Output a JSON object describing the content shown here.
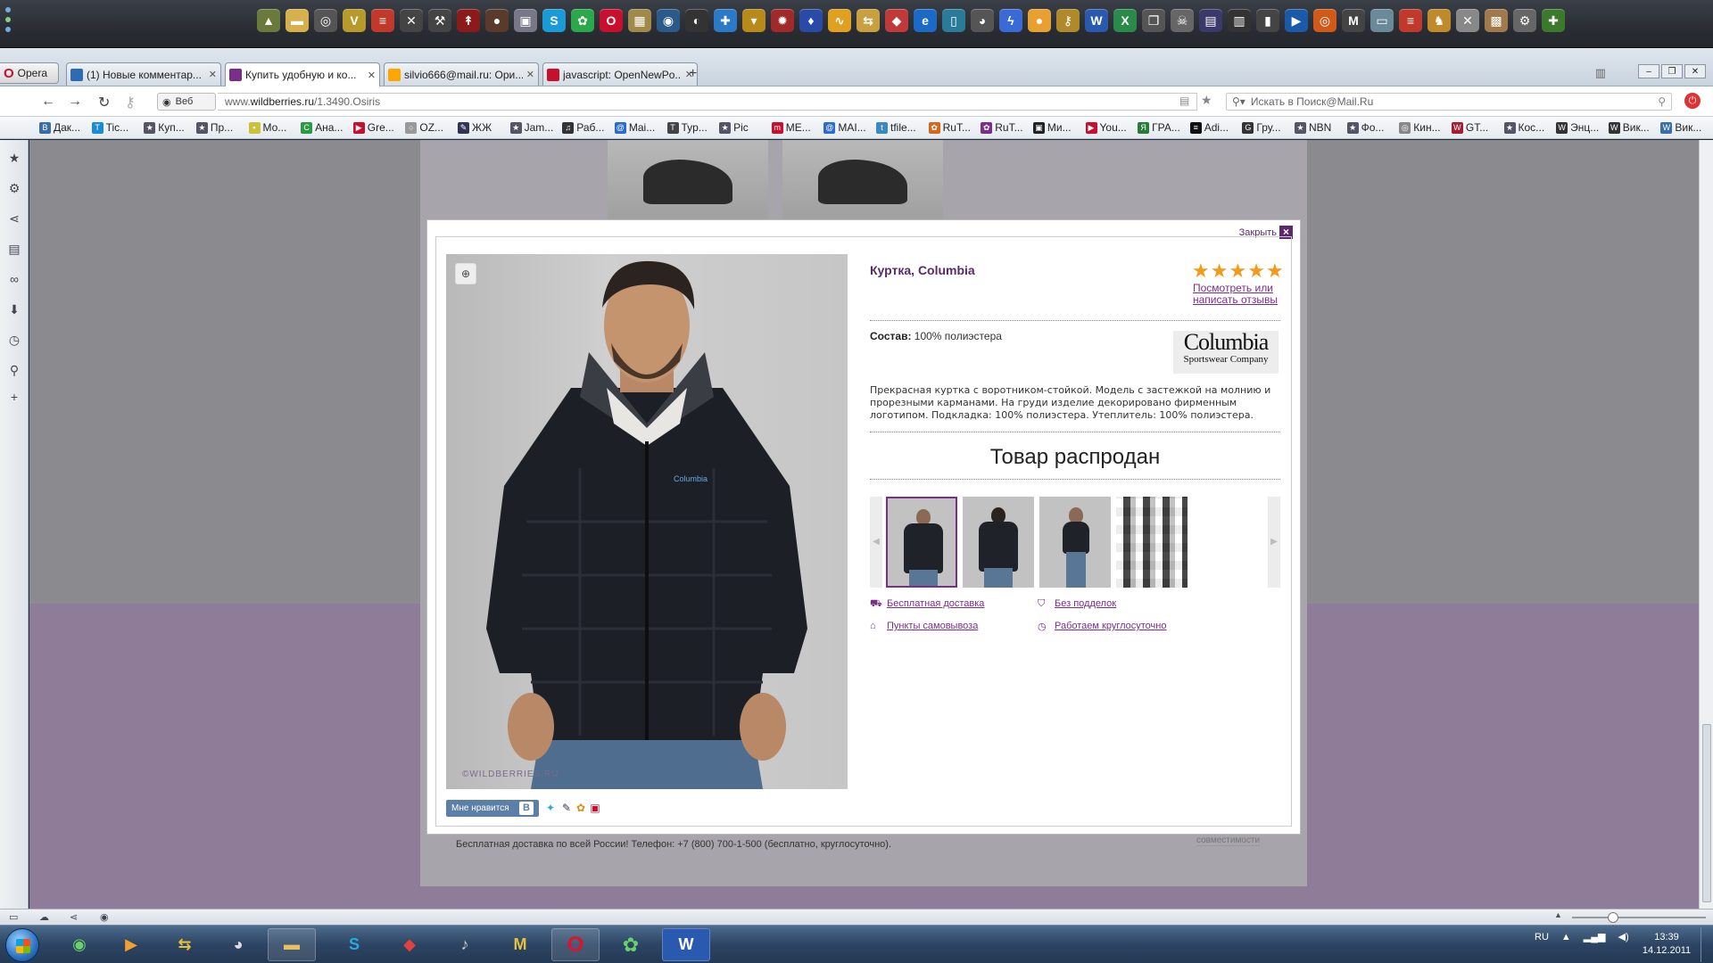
{
  "browser": {
    "menu_label": "Opera",
    "tabs": [
      {
        "title": "(1) Новые комментар...",
        "fav_color": "#2e6bb5",
        "active": false
      },
      {
        "title": "Купить удобную и ко...",
        "fav_color": "#7a2d8a",
        "active": true
      },
      {
        "title": "silvio666@mail.ru: Ори...",
        "fav_color": "#ffa500",
        "active": false
      },
      {
        "title": "javascript: OpenNewPo...",
        "fav_color": "#c8102e",
        "active": false
      }
    ],
    "address_badge": "Веб",
    "url_prefix": "www.",
    "url_host": "wildberries.ru",
    "url_path": "/1.3490.Osiris",
    "search_placeholder": "Искать в Поиск@Mail.Ru",
    "bookmarks": [
      {
        "label": "Дак...",
        "c": "#3a6ea5",
        "g": "В"
      },
      {
        "label": "Tic...",
        "c": "#1a8ad1",
        "g": "T"
      },
      {
        "label": "Куп...",
        "c": "#556",
        "g": "★"
      },
      {
        "label": "Пр...",
        "c": "#556",
        "g": "★"
      },
      {
        "label": "Мо...",
        "c": "#c9c23a",
        "g": "▪"
      },
      {
        "label": "Ана...",
        "c": "#2a9a44",
        "g": "C"
      },
      {
        "label": "Gre...",
        "c": "#c8102e",
        "g": "▶"
      },
      {
        "label": "OZ...",
        "c": "#999",
        "g": "○"
      },
      {
        "label": "ЖЖ",
        "c": "#335",
        "g": "✎"
      },
      {
        "label": "Jam...",
        "c": "#556",
        "g": "★"
      },
      {
        "label": "Раб...",
        "c": "#333",
        "g": "♫"
      },
      {
        "label": "Mai...",
        "c": "#2a6ad1",
        "g": "@"
      },
      {
        "label": "Typ...",
        "c": "#444",
        "g": "T"
      },
      {
        "label": "Pic",
        "c": "#556",
        "g": "★"
      },
      {
        "label": "ME...",
        "c": "#c8102e",
        "g": "m"
      },
      {
        "label": "MAI...",
        "c": "#2a6ad1",
        "g": "@"
      },
      {
        "label": "tfile...",
        "c": "#3a8ac1",
        "g": "t"
      },
      {
        "label": "RuT...",
        "c": "#d2691e",
        "g": "✿"
      },
      {
        "label": "RuT...",
        "c": "#7a2d8a",
        "g": "✿"
      },
      {
        "label": "Ми...",
        "c": "#222",
        "g": "▣"
      },
      {
        "label": "You...",
        "c": "#c8102e",
        "g": "▶"
      },
      {
        "label": "ГРА...",
        "c": "#2a7a3a",
        "g": "Я"
      },
      {
        "label": "Adi...",
        "c": "#111",
        "g": "≡"
      },
      {
        "label": "Гру...",
        "c": "#333",
        "g": "G"
      },
      {
        "label": "NBN",
        "c": "#556",
        "g": "★"
      },
      {
        "label": "Фо...",
        "c": "#556",
        "g": "★"
      },
      {
        "label": "Кин...",
        "c": "#888",
        "g": "◎"
      },
      {
        "label": "GT...",
        "c": "#a51c30",
        "g": "W"
      },
      {
        "label": "Кос...",
        "c": "#556",
        "g": "★"
      },
      {
        "label": "Энц...",
        "c": "#333",
        "g": "W"
      },
      {
        "label": "Вик...",
        "c": "#333",
        "g": "W"
      },
      {
        "label": "Вик...",
        "c": "#3a6ea5",
        "g": "W"
      }
    ]
  },
  "page": {
    "footer_text": "Бесплатная доставка по всей России! Телефон: +7 (800) 700-1-500 (бесплатно, круглосуточно).",
    "compat_label": "совместимости"
  },
  "modal": {
    "close_label": "Закрыть",
    "product_title": "Куртка, Columbia",
    "rating": 5,
    "reviews_link": "Посмотреть или написать отзывы",
    "composition_label": "Состав:",
    "composition_value": "100% полиэстера",
    "brand_name": "Columbia",
    "brand_tagline": "Sportswear Company",
    "description": "Прекрасная куртка с воротником-стойкой. Модель с застежкой на молнию и прорезными карманами. На груди изделие декорировано фирменным логотипом. Подкладка: 100% полиэстера. Утеплитель: 100% полиэстера.",
    "status": "Товар распродан",
    "watermark": "©WILDBERRIES.RU",
    "chest_logo": "Columbia",
    "like_label": "Мне нравится",
    "vk_label": "В",
    "features": [
      {
        "label": "Бесплатная доставка",
        "icon": "truck-icon"
      },
      {
        "label": "Без подделок",
        "icon": "shield-icon"
      },
      {
        "label": "Пункты самовывоза",
        "icon": "pickup-icon"
      },
      {
        "label": "Работаем круглосуточно",
        "icon": "clock-icon"
      }
    ]
  },
  "taskbar": {
    "lang": "RU",
    "time": "13:39",
    "date": "14.12.2011"
  }
}
